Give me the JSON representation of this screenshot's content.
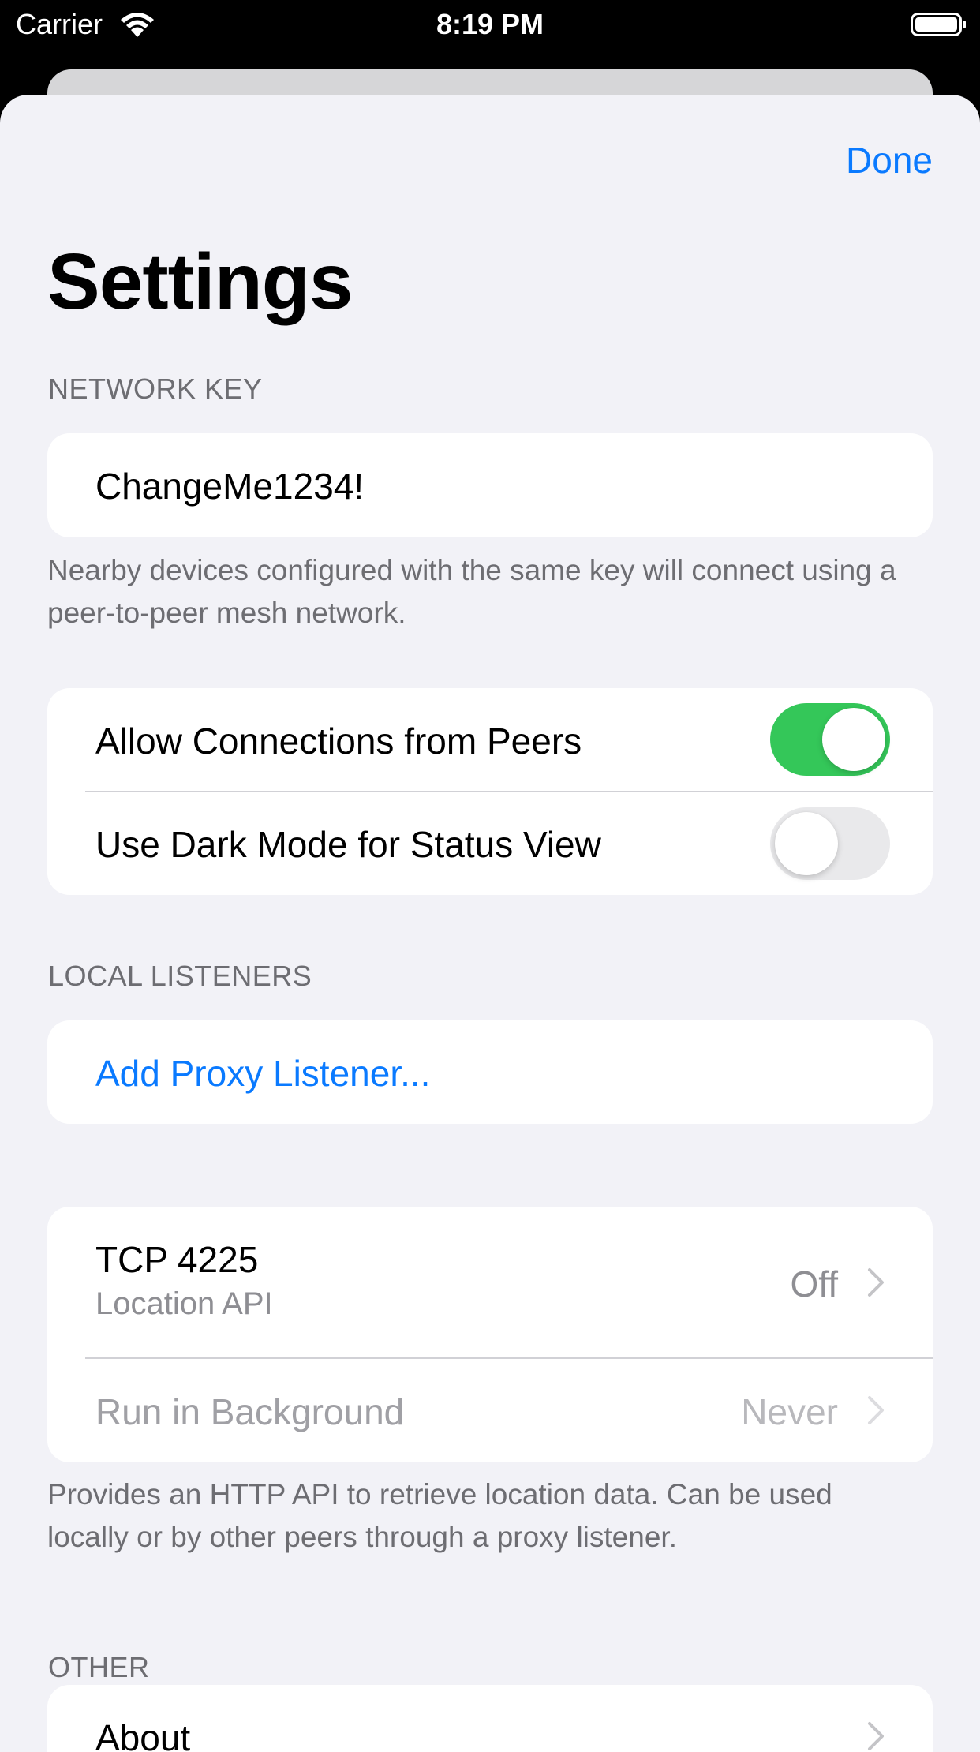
{
  "status_bar": {
    "carrier": "Carrier",
    "time": "8:19 PM"
  },
  "nav": {
    "done_label": "Done"
  },
  "title": "Settings",
  "network_key": {
    "header": "NETWORK KEY",
    "value": "ChangeMe1234!",
    "footer": "Nearby devices configured with the same key will connect using a peer-to-peer mesh network."
  },
  "toggles": {
    "allow_connections": {
      "label": "Allow Connections from Peers",
      "on": true
    },
    "dark_mode": {
      "label": "Use Dark Mode for Status View",
      "on": false
    }
  },
  "local_listeners": {
    "header": "LOCAL LISTENERS",
    "add_label": "Add Proxy Listener..."
  },
  "tcp_listener": {
    "title": "TCP 4225",
    "subtitle": "Location API",
    "value": "Off",
    "background_label": "Run in Background",
    "background_value": "Never",
    "footer": "Provides an HTTP API to retrieve location data. Can be used locally or by other peers through a proxy listener."
  },
  "other": {
    "header": "OTHER",
    "about_label": "About"
  },
  "colors": {
    "accent": "#0a7aff",
    "toggle_on": "#34c759",
    "background": "#f2f2f7"
  }
}
